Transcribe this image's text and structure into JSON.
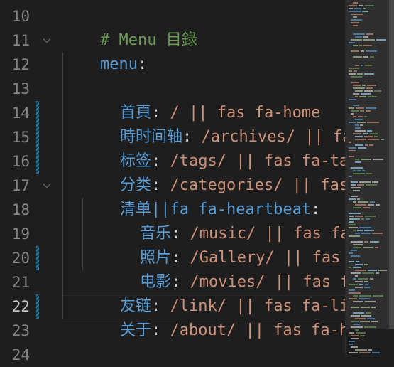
{
  "gutter": {
    "line_numbers": [
      "10",
      "11",
      "12",
      "13",
      "14",
      "15",
      "16",
      "17",
      "18",
      "19",
      "20",
      "21",
      "22",
      "23",
      "24"
    ],
    "active_line": "22"
  },
  "code": {
    "l10": {
      "comment": "# Menu 目錄"
    },
    "l11": {
      "key": "menu",
      "colon": ":"
    },
    "l13": {
      "key": "首頁",
      "colon": ":",
      "value": " / || fas fa-home"
    },
    "l14": {
      "key": "時时间轴",
      "colon": ":",
      "value": " /archives/ || fas fa-archive"
    },
    "l15": {
      "key": "标签",
      "colon": ":",
      "value": " /tags/ || fas fa-tags"
    },
    "l16": {
      "key": "分类",
      "colon": ":",
      "value": " /categories/ || fas fa-folder-open"
    },
    "l17": {
      "key": "清单||fa fa-heartbeat",
      "colon": ":"
    },
    "l18": {
      "key": "音乐",
      "colon": ":",
      "value": " /music/ || fas fa-music"
    },
    "l19": {
      "key": "照片",
      "colon": ":",
      "value": " /Gallery/ || fas fa-images"
    },
    "l20": {
      "key": "电影",
      "colon": ":",
      "value": " /movies/ || fas fa-video"
    },
    "l21": {
      "key": "友链",
      "colon": ":",
      "value": " /link/ || fas fa-link"
    },
    "l22": {
      "key": "关于",
      "colon": ":",
      "value": " /about/ || fas fa-heart"
    }
  },
  "colors": {
    "background": "#1e1e1e",
    "comment": "#6a9955",
    "key": "#569cd6",
    "string": "#ce9178",
    "line_number": "#858585",
    "modified_bar": "#1b81a8"
  }
}
